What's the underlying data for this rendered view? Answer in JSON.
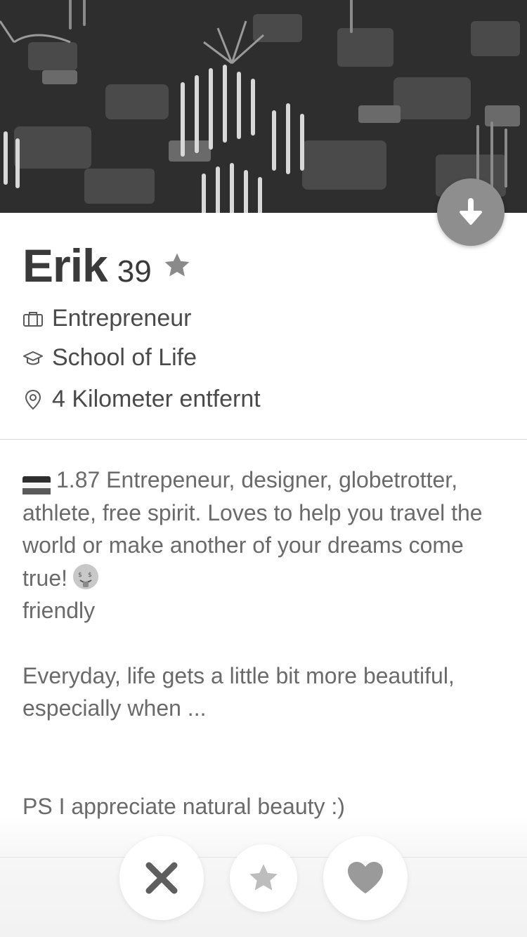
{
  "profile": {
    "name": "Erik",
    "age": "39",
    "job": "Entrepreneur",
    "school": "School of Life",
    "distance": "4 Kilometer entfernt"
  },
  "bio": {
    "line1": "1.87 Entrepeneur, designer, globetrotter, athlete, free spirit. Loves to help you travel the world or make another of your dreams come true!",
    "line1_tail": "friendly",
    "line2": "Everyday, life gets a little bit more beautiful, especially when ...",
    "line3": "PS I appreciate natural beauty :)"
  },
  "icons": {
    "collapse": "arrow-down-icon",
    "star_badge": "star-icon",
    "job": "briefcase-icon",
    "school": "graduation-cap-icon",
    "distance": "location-pin-icon",
    "flag": "flag-icon",
    "emoji": "money-mouth-face-icon",
    "nope": "close-icon",
    "super_like": "star-icon",
    "like": "heart-icon"
  },
  "colors": {
    "text": "#3a3a3a",
    "secondary_text": "#6a6a6a",
    "button_gray": "#8e8e8e"
  }
}
